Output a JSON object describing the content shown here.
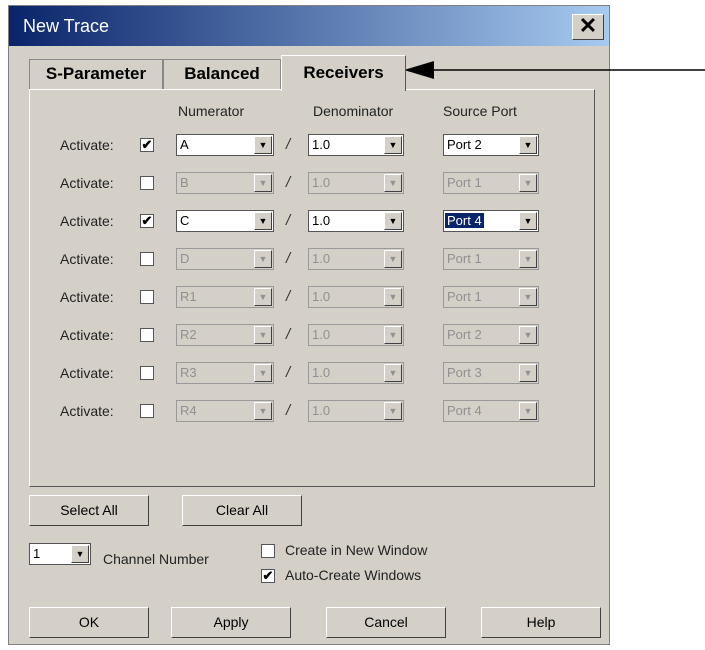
{
  "window": {
    "title": "New Trace",
    "close_glyph": "✕"
  },
  "tabs": [
    {
      "label": "S-Parameter",
      "active": false
    },
    {
      "label": "Balanced",
      "active": false
    },
    {
      "label": "Receivers",
      "active": true
    }
  ],
  "columns": {
    "numerator": "Numerator",
    "denominator": "Denominator",
    "source_port": "Source Port"
  },
  "rows": [
    {
      "activate_label": "Activate:",
      "checked": true,
      "numerator": "A",
      "denominator": "1.0",
      "source_port": "Port 2",
      "enabled": true
    },
    {
      "activate_label": "Activate:",
      "checked": false,
      "numerator": "B",
      "denominator": "1.0",
      "source_port": "Port 1",
      "enabled": false
    },
    {
      "activate_label": "Activate:",
      "checked": true,
      "numerator": "C",
      "denominator": "1.0",
      "source_port": "Port 4",
      "enabled": true,
      "port_highlighted": true
    },
    {
      "activate_label": "Activate:",
      "checked": false,
      "numerator": "D",
      "denominator": "1.0",
      "source_port": "Port 1",
      "enabled": false
    },
    {
      "activate_label": "Activate:",
      "checked": false,
      "numerator": "R1",
      "denominator": "1.0",
      "source_port": "Port 1",
      "enabled": false
    },
    {
      "activate_label": "Activate:",
      "checked": false,
      "numerator": "R2",
      "denominator": "1.0",
      "source_port": "Port 2",
      "enabled": false
    },
    {
      "activate_label": "Activate:",
      "checked": false,
      "numerator": "R3",
      "denominator": "1.0",
      "source_port": "Port 3",
      "enabled": false
    },
    {
      "activate_label": "Activate:",
      "checked": false,
      "numerator": "R4",
      "denominator": "1.0",
      "source_port": "Port 4",
      "enabled": false
    }
  ],
  "divider": "/",
  "arrow_glyph": "▼",
  "check_glyph": "✔",
  "buttons": {
    "select_all": "Select All",
    "clear_all": "Clear All",
    "ok": "OK",
    "apply": "Apply",
    "cancel": "Cancel",
    "help": "Help"
  },
  "channel": {
    "value": "1",
    "label": "Channel Number"
  },
  "options": {
    "create_new_window": {
      "label": "Create in New Window",
      "checked": false
    },
    "auto_create_windows": {
      "label": "Auto-Create Windows",
      "checked": true
    }
  }
}
